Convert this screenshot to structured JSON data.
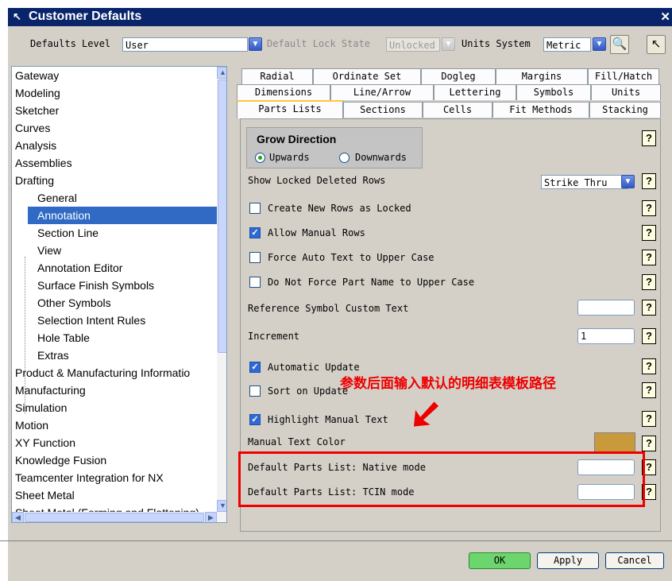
{
  "window": {
    "title": "Customer Defaults",
    "close_glyph": "✕"
  },
  "topbar": {
    "defaults_level_label": "Defaults Level",
    "defaults_level_value": "User",
    "lock_state_label": "Default Lock State",
    "lock_state_value": "Unlocked",
    "units_label": "Units System",
    "units_value": "Metric"
  },
  "sidebar": {
    "items": [
      {
        "label": "Gateway",
        "sub": false
      },
      {
        "label": "Modeling",
        "sub": false
      },
      {
        "label": "Sketcher",
        "sub": false
      },
      {
        "label": "Curves",
        "sub": false
      },
      {
        "label": "Analysis",
        "sub": false
      },
      {
        "label": "Assemblies",
        "sub": false
      },
      {
        "label": "Drafting",
        "sub": false
      },
      {
        "label": "General",
        "sub": true
      },
      {
        "label": "Annotation",
        "sub": true,
        "selected": true
      },
      {
        "label": "Section Line",
        "sub": true
      },
      {
        "label": "View",
        "sub": true
      },
      {
        "label": "Annotation Editor",
        "sub": true
      },
      {
        "label": "Surface Finish Symbols",
        "sub": true
      },
      {
        "label": "Other Symbols",
        "sub": true
      },
      {
        "label": "Selection Intent Rules",
        "sub": true
      },
      {
        "label": "Hole Table",
        "sub": true
      },
      {
        "label": "Extras",
        "sub": true
      },
      {
        "label": "Product & Manufacturing Informatio",
        "sub": false
      },
      {
        "label": "Manufacturing",
        "sub": false
      },
      {
        "label": "Simulation",
        "sub": false
      },
      {
        "label": "Motion",
        "sub": false
      },
      {
        "label": "XY Function",
        "sub": false
      },
      {
        "label": "Knowledge Fusion",
        "sub": false
      },
      {
        "label": "Teamcenter Integration for NX",
        "sub": false
      },
      {
        "label": "Sheet Metal",
        "sub": false
      },
      {
        "label": "Sheet Metal (Forming and Flattening)",
        "sub": false
      }
    ]
  },
  "tabs": {
    "row1": [
      "Radial",
      "Ordinate Set",
      "Dogleg",
      "Margins",
      "Fill/Hatch"
    ],
    "row2": [
      "Dimensions",
      "Line/Arrow",
      "Lettering",
      "Symbols",
      "Units"
    ],
    "row3": [
      "Parts Lists",
      "Sections",
      "Cells",
      "Fit Methods",
      "Stacking"
    ]
  },
  "panel": {
    "grow_direction_title": "Grow Direction",
    "upwards": "Upwards",
    "downwards": "Downwards",
    "show_locked_deleted_rows": "Show Locked Deleted Rows",
    "strike_thru_value": "Strike Thru",
    "create_new_rows_locked": "Create New Rows as Locked",
    "allow_manual_rows": "Allow Manual Rows",
    "force_auto_upper": "Force Auto Text to Upper Case",
    "do_not_force_part_name": "Do Not Force Part Name to Upper Case",
    "reference_symbol_custom_text": "Reference Symbol Custom Text",
    "reference_symbol_value": "",
    "increment": "Increment",
    "increment_value": "1",
    "automatic_update": "Automatic Update",
    "sort_on_update": "Sort on Update",
    "highlight_manual_text": "Highlight Manual Text",
    "manual_text_color": "Manual Text Color",
    "manual_text_color_hex": "#c89a3c",
    "default_parts_list_native": "Default Parts List: Native mode",
    "default_parts_list_native_value": "",
    "default_parts_list_tcin": "Default Parts List: TCIN mode",
    "default_parts_list_tcin_value": "",
    "help_glyph": "?"
  },
  "annotation": {
    "text": "参数后面输入默认的明细表模板路径",
    "arrow_glyph": "➘",
    "color": "#e00000"
  },
  "buttons": {
    "ok": "OK",
    "apply": "Apply",
    "cancel": "Cancel"
  }
}
